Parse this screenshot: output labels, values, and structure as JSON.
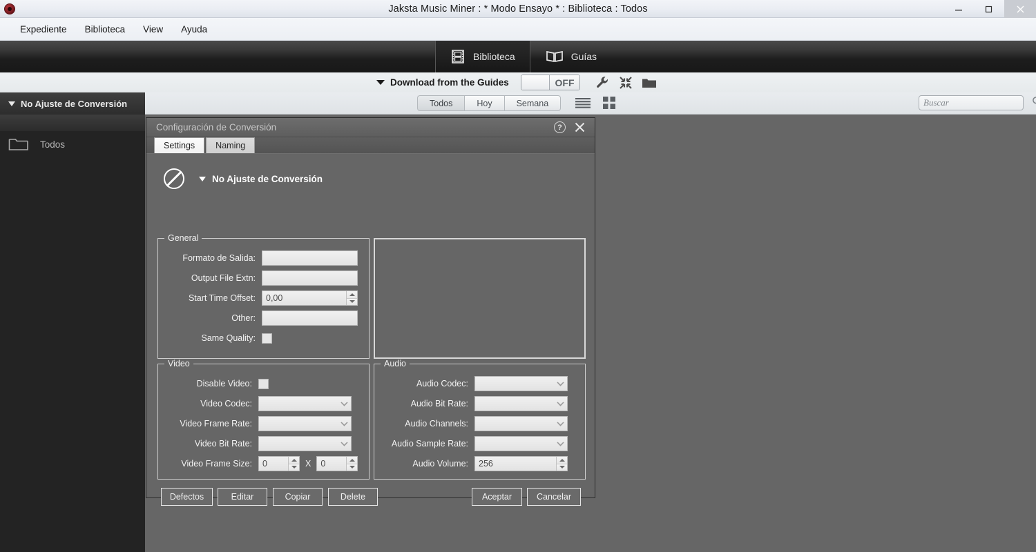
{
  "window": {
    "title": "Jaksta Music Miner : * Modo Ensayo * : Biblioteca : Todos",
    "app_icon": "jaksta-logo-icon",
    "minimize": "minimize-icon",
    "maximize": "restore-icon",
    "close": "close-icon"
  },
  "menubar": {
    "items": [
      {
        "label": "Expediente"
      },
      {
        "label": "Biblioteca"
      },
      {
        "label": "View"
      },
      {
        "label": "Ayuda"
      }
    ]
  },
  "navtabs": [
    {
      "label": "Biblioteca",
      "icon": "film-strip-icon",
      "active": true
    },
    {
      "label": "Guías",
      "icon": "book-icon",
      "active": false
    }
  ],
  "toolbar": {
    "download_label": "Download from the Guides",
    "toggle_state": "OFF",
    "icons": [
      {
        "name": "wrench-icon"
      },
      {
        "name": "collapse-icon"
      },
      {
        "name": "folder-icon"
      }
    ]
  },
  "filterbar": {
    "segments": [
      {
        "label": "Todos",
        "active": true
      },
      {
        "label": "Hoy",
        "active": false
      },
      {
        "label": "Semana",
        "active": false
      }
    ],
    "view_icons": [
      {
        "name": "list-view-icon"
      },
      {
        "name": "grid-view-icon"
      }
    ],
    "search": {
      "value": "",
      "placeholder": "Buscar",
      "icon": "search-icon"
    }
  },
  "sidebar": {
    "conversion_header": "No Ajuste de Conversión",
    "items": [
      {
        "label": "Todos",
        "icon": "folder-icon"
      }
    ]
  },
  "dialog": {
    "title": "Configuración de Conversión",
    "help_label": "?",
    "close_label": "✕",
    "tabs": [
      {
        "label": "Settings",
        "active": true
      },
      {
        "label": "Naming",
        "active": false
      }
    ],
    "profile": {
      "icon": "no-conversion-icon",
      "name": "No Ajuste de Conversión"
    },
    "groups": {
      "general": {
        "title": "General",
        "fields": [
          {
            "label": "Formato de Salida:",
            "value": "",
            "type": "text"
          },
          {
            "label": "Output File Extn:",
            "value": "",
            "type": "text"
          },
          {
            "label": "Start Time Offset:",
            "value": "0,00",
            "type": "spinner"
          },
          {
            "label": "Other:",
            "value": "",
            "type": "text"
          },
          {
            "label": "Same Quality:",
            "value": "",
            "type": "checkbox",
            "checked": false
          }
        ]
      },
      "preview": {
        "title": "",
        "content": ""
      },
      "video": {
        "title": "Video",
        "fields": [
          {
            "label": "Disable Video:",
            "value": "",
            "type": "checkbox",
            "checked": false
          },
          {
            "label": "Video Codec:",
            "value": "",
            "type": "combo"
          },
          {
            "label": "Video Frame Rate:",
            "value": "",
            "type": "combo"
          },
          {
            "label": "Video Bit Rate:",
            "value": "",
            "type": "combo"
          },
          {
            "label": "Video Frame Size:",
            "value": "0",
            "value2": "0",
            "separator": "X",
            "type": "size"
          }
        ]
      },
      "audio": {
        "title": "Audio",
        "fields": [
          {
            "label": "Audio Codec:",
            "value": "",
            "type": "combo"
          },
          {
            "label": "Audio Bit Rate:",
            "value": "",
            "type": "combo"
          },
          {
            "label": "Audio Channels:",
            "value": "",
            "type": "combo"
          },
          {
            "label": "Audio Sample Rate:",
            "value": "",
            "type": "combo"
          },
          {
            "label": "Audio Volume:",
            "value": "256",
            "type": "spinner"
          }
        ]
      }
    },
    "buttons": {
      "defaults": "Defectos",
      "edit": "Editar",
      "copy": "Copiar",
      "delete": "Delete",
      "accept": "Aceptar",
      "cancel": "Cancelar"
    }
  },
  "colors": {
    "dialog_bg": "#666666",
    "sidebar_bg": "#232323",
    "nav_band": "#1d1d1d",
    "accent_red": "#7d1c22"
  }
}
